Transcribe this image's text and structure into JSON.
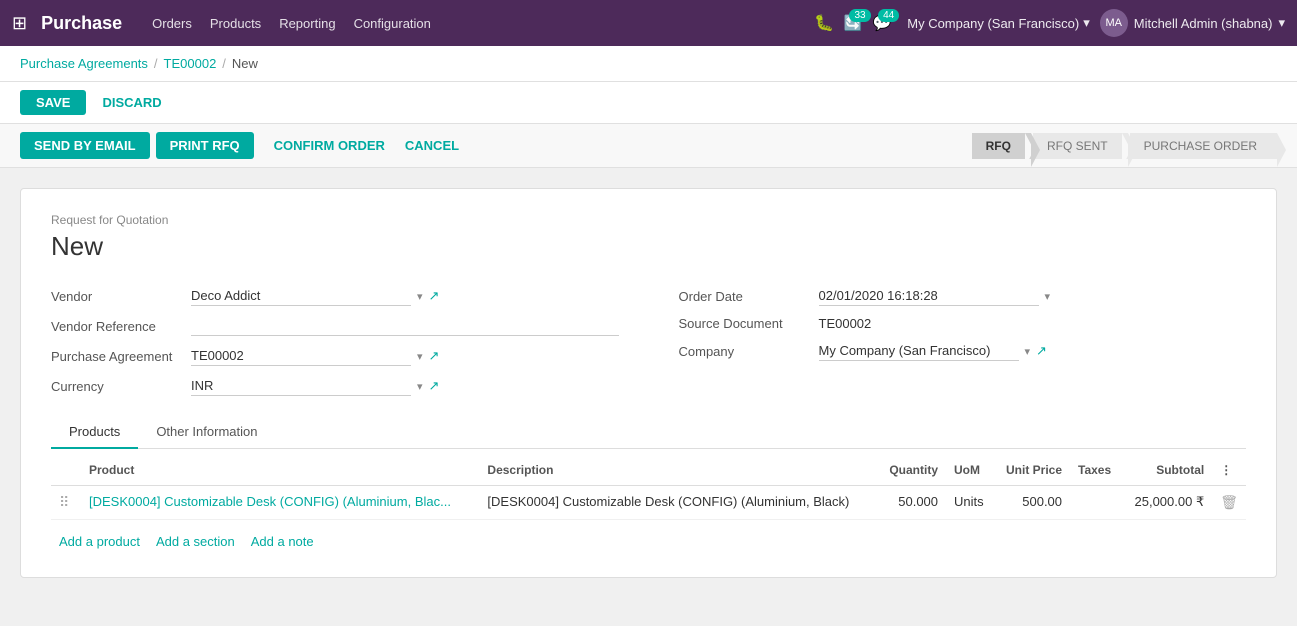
{
  "app": {
    "name": "Purchase",
    "grid_icon": "⊞"
  },
  "topnav": {
    "menu_items": [
      "Orders",
      "Products",
      "Reporting",
      "Configuration"
    ],
    "debug_icon": "🐛",
    "chat_count": "33",
    "discuss_count": "44",
    "company": "My Company (San Francisco)",
    "user": "Mitchell Admin (shabna)"
  },
  "breadcrumb": {
    "parts": [
      "Purchase Agreements",
      "TE00002",
      "New"
    ],
    "separators": [
      "/",
      "/"
    ]
  },
  "action_bar": {
    "save_label": "SAVE",
    "discard_label": "DISCARD"
  },
  "workflow_bar": {
    "send_by_email": "SEND BY EMAIL",
    "print_rfq": "PRINT RFQ",
    "confirm_order": "CONFIRM ORDER",
    "cancel": "CANCEL",
    "steps": [
      "RFQ",
      "RFQ SENT",
      "PURCHASE ORDER"
    ],
    "active_step": 0
  },
  "form": {
    "label": "Request for Quotation",
    "title": "New",
    "vendor_label": "Vendor",
    "vendor_value": "Deco Addict",
    "vendor_ref_label": "Vendor Reference",
    "vendor_ref_value": "",
    "purchase_agreement_label": "Purchase Agreement",
    "purchase_agreement_value": "TE00002",
    "currency_label": "Currency",
    "currency_value": "INR",
    "order_date_label": "Order Date",
    "order_date_value": "02/01/2020 16:18:28",
    "source_doc_label": "Source Document",
    "source_doc_value": "TE00002",
    "company_label": "Company",
    "company_value": "My Company (San Francisco)"
  },
  "tabs": {
    "items": [
      "Products",
      "Other Information"
    ],
    "active": 0
  },
  "table": {
    "headers": [
      "Product",
      "Description",
      "Quantity",
      "UoM",
      "Unit Price",
      "Taxes",
      "Subtotal",
      ""
    ],
    "rows": [
      {
        "product": "[DESK0004] Customizable Desk (CONFIG) (Aluminium, Blac...",
        "description": "[DESK0004] Customizable Desk (CONFIG) (Aluminium, Black)",
        "quantity": "50.000",
        "uom": "Units",
        "unit_price": "500.00",
        "taxes": "",
        "subtotal": "25,000.00 ₹"
      }
    ],
    "add_product": "Add a product",
    "add_section": "Add a section",
    "add_note": "Add a note"
  }
}
